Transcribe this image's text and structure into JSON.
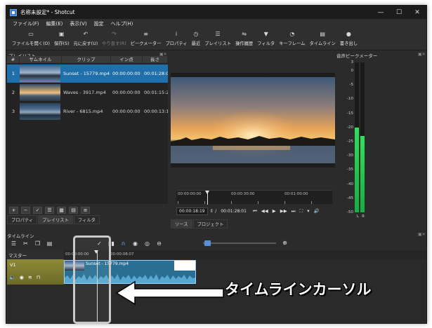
{
  "window": {
    "title": "名称未設定* - Shotcut",
    "controls": [
      "—",
      "☐",
      "✕"
    ]
  },
  "menu": [
    "ファイル(F)",
    "編集(E)",
    "表示(V)",
    "設定",
    "ヘルプ(H)"
  ],
  "toolbar": [
    {
      "label": "ファイルを開く(O)",
      "icon": "folder-icon",
      "glyph": "▭",
      "enabled": true
    },
    {
      "label": "保存(S)",
      "icon": "save-icon",
      "glyph": "▣",
      "enabled": true
    },
    {
      "label": "元に戻す(U)",
      "icon": "undo-icon",
      "glyph": "↶",
      "enabled": true
    },
    {
      "label": "やり直す(R)",
      "icon": "redo-icon",
      "glyph": "↷",
      "enabled": false
    },
    {
      "label": "ピークメーター",
      "icon": "meter-icon",
      "glyph": "≡",
      "enabled": true
    },
    {
      "label": "プロパティ",
      "icon": "info-icon",
      "glyph": "i",
      "enabled": true
    },
    {
      "label": "最近",
      "icon": "clock-icon",
      "glyph": "◷",
      "enabled": true
    },
    {
      "label": "プレイリスト",
      "icon": "list-icon",
      "glyph": "☰",
      "enabled": true
    },
    {
      "label": "操作履歴",
      "icon": "history-icon",
      "glyph": "⇋",
      "enabled": true
    },
    {
      "label": "フィルタ",
      "icon": "filter-icon",
      "glyph": "▼",
      "enabled": true
    },
    {
      "label": "キーフレーム",
      "icon": "keyframe-icon",
      "glyph": "◔",
      "enabled": true
    },
    {
      "label": "タイムライン",
      "icon": "timeline-icon",
      "glyph": "▤",
      "enabled": true
    },
    {
      "label": "書き出し",
      "icon": "export-icon",
      "glyph": "●",
      "enabled": true
    }
  ],
  "playlist": {
    "title": "プレイリスト",
    "columns": [
      "#",
      "サムネイル",
      "クリップ",
      "イン点",
      "長さ"
    ],
    "rows": [
      {
        "num": "1",
        "clip": "Sunset - 15779.mp4",
        "in": "00:00:00:00",
        "len": "00:01:28:0",
        "thumb": "sunset",
        "selected": true
      },
      {
        "num": "2",
        "clip": "Waves - 3917.mp4",
        "in": "00:00:00:00",
        "len": "00:01:15:2",
        "thumb": "waves",
        "selected": false
      },
      {
        "num": "3",
        "clip": "River - 6815.mp4",
        "in": "00:00:00:00",
        "len": "00:00:13:1",
        "thumb": "river",
        "selected": false
      }
    ],
    "bottom_buttons": [
      "+",
      "−",
      "✓",
      "☰",
      "▦",
      "▤",
      "≡"
    ],
    "tabs": [
      "プロパティ",
      "プレイリスト",
      "フィルタ"
    ]
  },
  "player": {
    "ruler_labels": [
      "00:00:00:00",
      "00:00:30:00",
      "00:01:00:00"
    ],
    "current_time": "00:00:18:19",
    "duration": "00:01:28:01",
    "transport": [
      "⏮",
      "◀◀",
      "▶",
      "▶▶",
      "⏭",
      "⛶",
      "▾",
      "🔊"
    ],
    "tabs": [
      "ソース",
      "プロジェクト"
    ]
  },
  "meter": {
    "title": "音声ピークメーター",
    "labels": [
      "3",
      "0",
      "-5",
      "-10",
      "-15",
      "-20",
      "-25",
      "-30",
      "-35",
      "-40",
      "-45",
      "-50"
    ],
    "channels": [
      "L",
      "R"
    ],
    "levels_db": [
      -20,
      -23
    ]
  },
  "timeline": {
    "title": "タイムライン",
    "master_label": "マスター",
    "ruler_labels": [
      "00:00:00:00",
      "00:00:08:07"
    ],
    "track_name": "V1",
    "clip_name": "Sunset - 15779.mp4"
  },
  "callout": {
    "text": "タイムラインカーソル"
  },
  "colors": {
    "selection": "#1e6faa",
    "track": "#8c8a35",
    "clip": "#2a6f93",
    "meter": "#2ee05b"
  }
}
